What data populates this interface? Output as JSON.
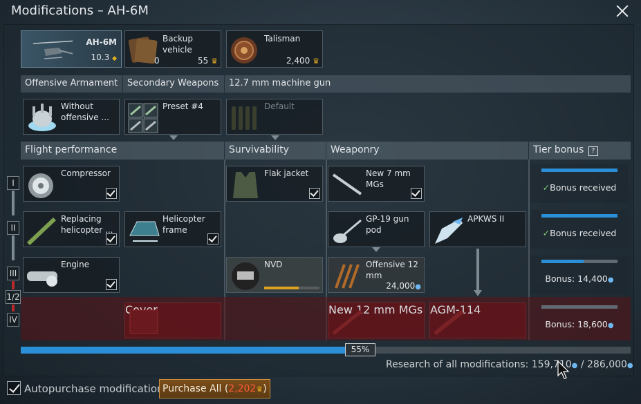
{
  "window": {
    "title": "Modifications – AH-6M"
  },
  "top_row": {
    "vehicle": {
      "name": "AH-6M",
      "br": "10.3"
    },
    "backup": {
      "label": "Backup vehicle",
      "count": "0",
      "cost": "55"
    },
    "talisman": {
      "label": "Talisman",
      "cost": "2,400"
    }
  },
  "loadout_headers": [
    "Offensive Armament",
    "Secondary Weapons",
    "12.7 mm machine gun"
  ],
  "loadout": {
    "offensive": "Without offensive ...",
    "secondary": "Preset #4",
    "mg": "Default"
  },
  "sections": {
    "flight": "Flight performance",
    "survivability": "Survivability",
    "weaponry": "Weaponry",
    "tier_bonus": "Tier bonus"
  },
  "tiers": [
    "I",
    "II",
    "III",
    "1/2",
    "IV"
  ],
  "mods": {
    "compressor": "Compressor",
    "replacing_helicopter": "Replacing helicopter ...",
    "helicopter_frame": "Helicopter frame",
    "engine": "Engine",
    "cover": "Cover",
    "flak_jacket": "Flak jacket",
    "nvd": "NVD",
    "new_7mm": "New 7 mm MGs",
    "gp19": "GP-19 gun pod",
    "apkws": "APKWS II",
    "offensive_12mm": "Offensive 12 mm",
    "offensive_12mm_cost": "24,000",
    "new_12mm": "New 12 mm MGs",
    "agm114": "AGM-114"
  },
  "nvd_progress": 0.62,
  "tier_bonus": [
    {
      "text": "Bonus received",
      "fill": 1.0
    },
    {
      "text": "Bonus received",
      "fill": 1.0
    },
    {
      "text": "Bonus: 14,400",
      "fill": 0.55
    },
    {
      "text": "Bonus: 18,600",
      "fill": 0.0
    }
  ],
  "progress": {
    "percent_label": "55%",
    "value": 0.55
  },
  "research": {
    "label": "Research of all modifications: 159,710",
    "total": "/ 286,000"
  },
  "footer": {
    "autopurchase_label": "Autopurchase modifications",
    "purchase_label": "Purchase All (",
    "purchase_cost": "2,202",
    "purchase_close": ")"
  },
  "colors": {
    "accent_blue": "#2a8fd6",
    "red_tier": "#5a1216",
    "purchase_bg": "#6b4416"
  }
}
